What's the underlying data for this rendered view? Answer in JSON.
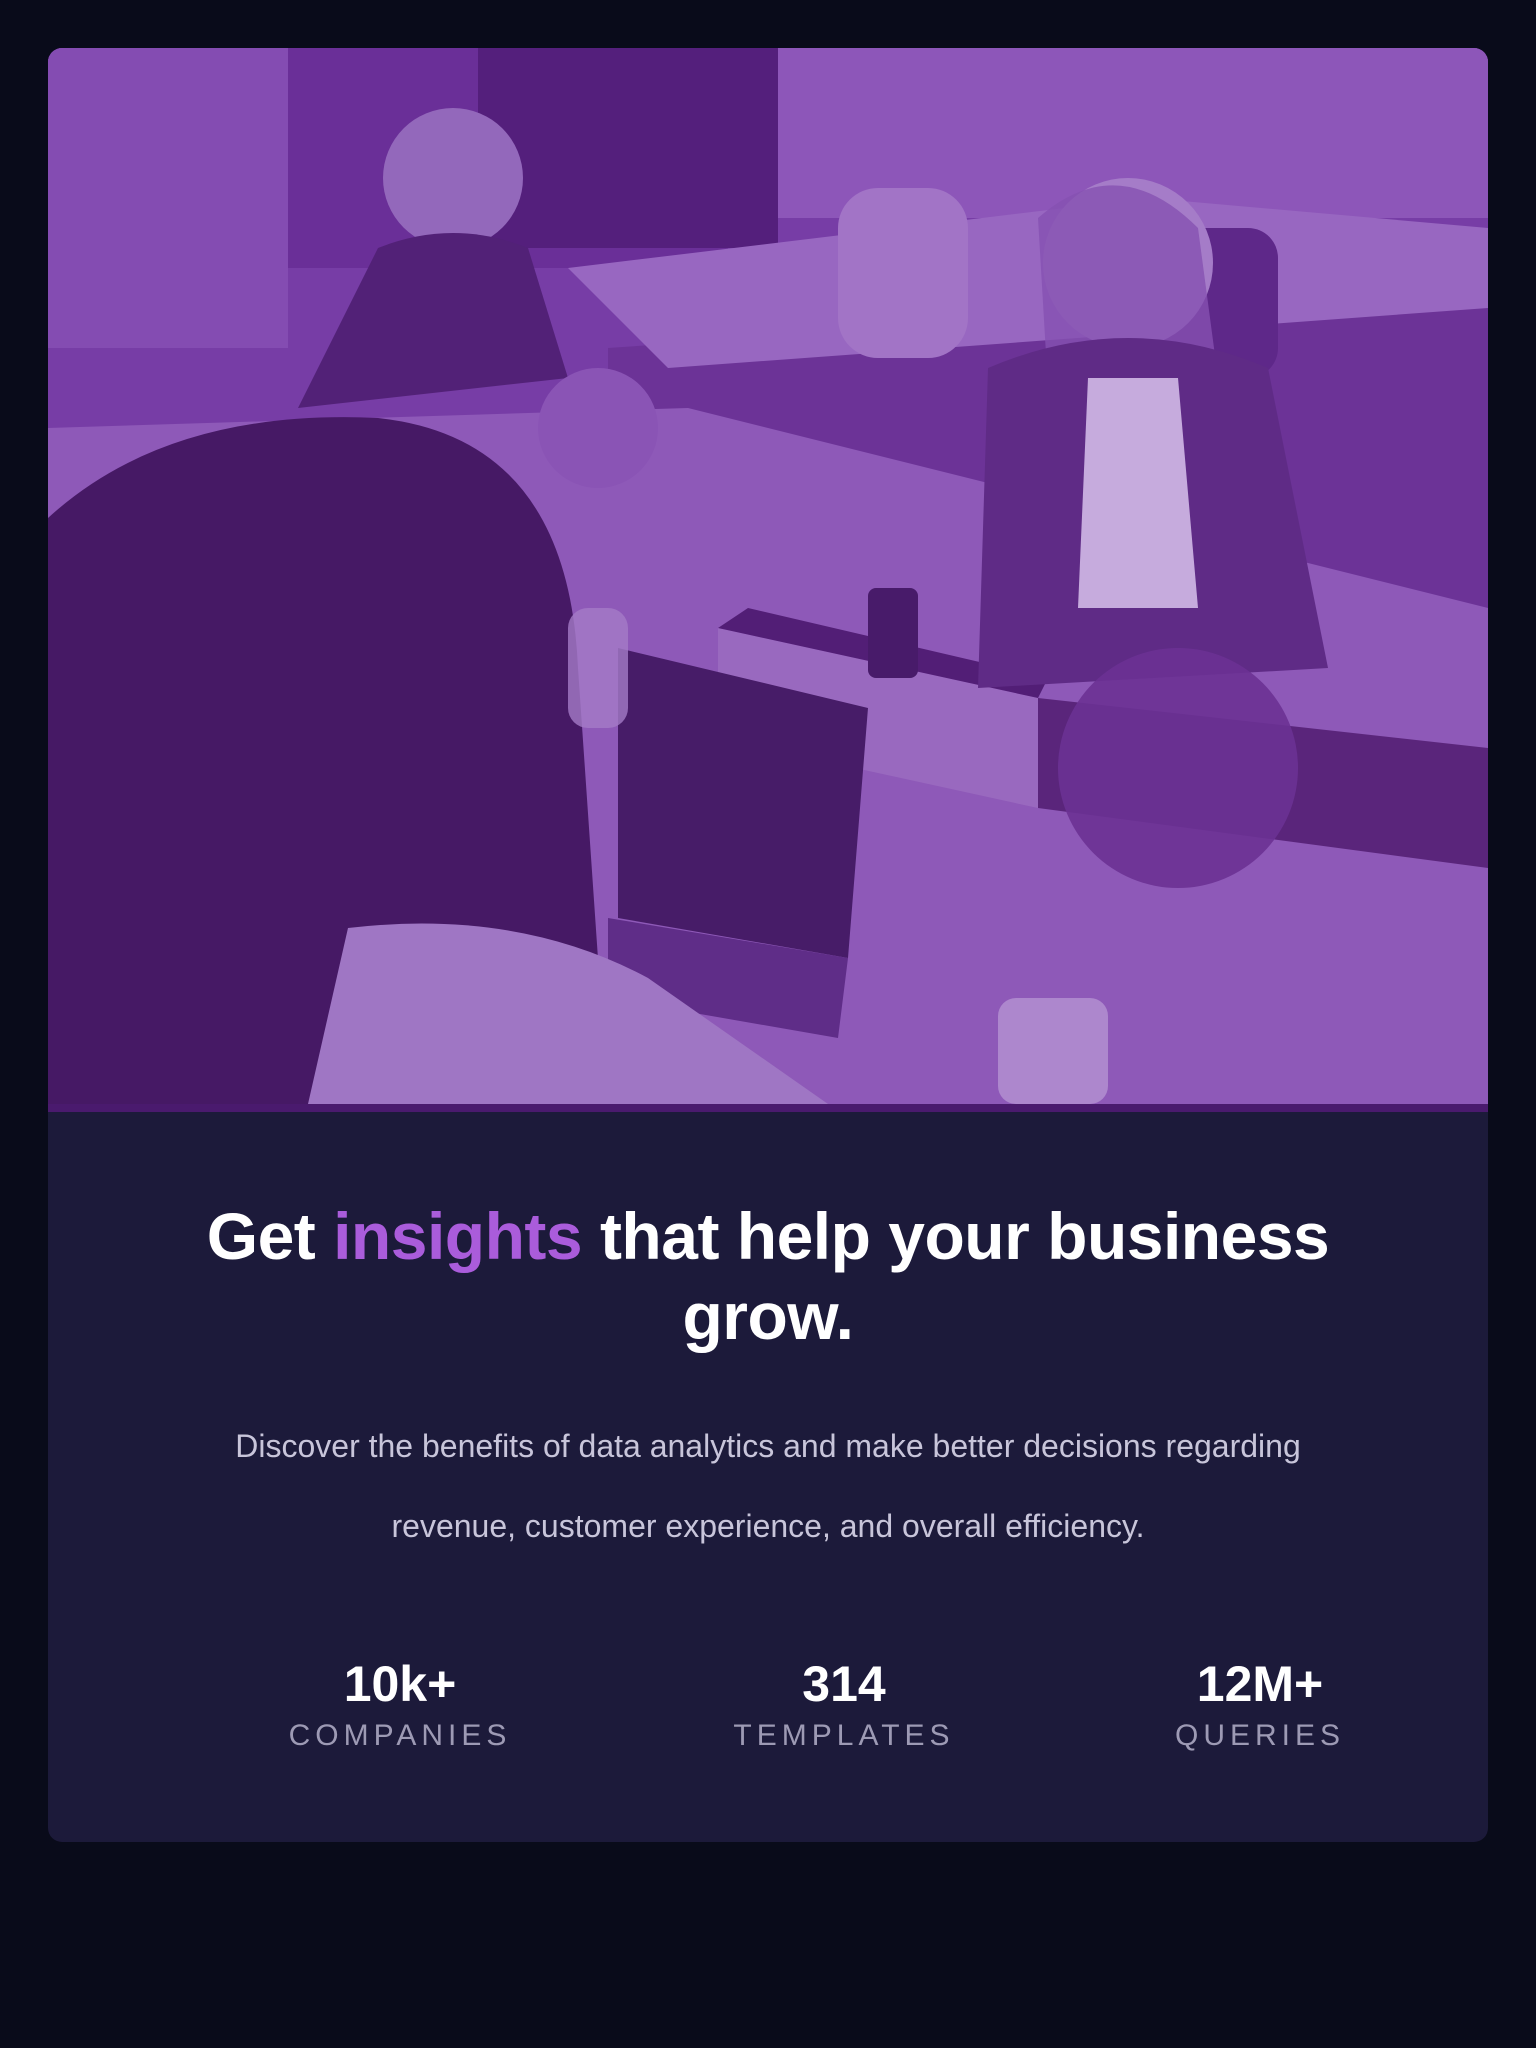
{
  "hero": {
    "icon": "office-team-photo"
  },
  "headline": {
    "before": "Get ",
    "accent": "insights",
    "after": " that help your business grow."
  },
  "description": "Discover the benefits of data analytics and make better decisions regarding revenue, customer experience, and overall efficiency.",
  "stats": [
    {
      "value": "10k+",
      "label": "COMPANIES"
    },
    {
      "value": "314",
      "label": "TEMPLATES"
    },
    {
      "value": "12M+",
      "label": "QUERIES"
    }
  ],
  "colors": {
    "page_background": "#090b1a",
    "card_background": "#1c1a3a",
    "accent": "#aa5cdb",
    "image_tint": "#6a3496",
    "muted_text": "#9d9ab4"
  }
}
